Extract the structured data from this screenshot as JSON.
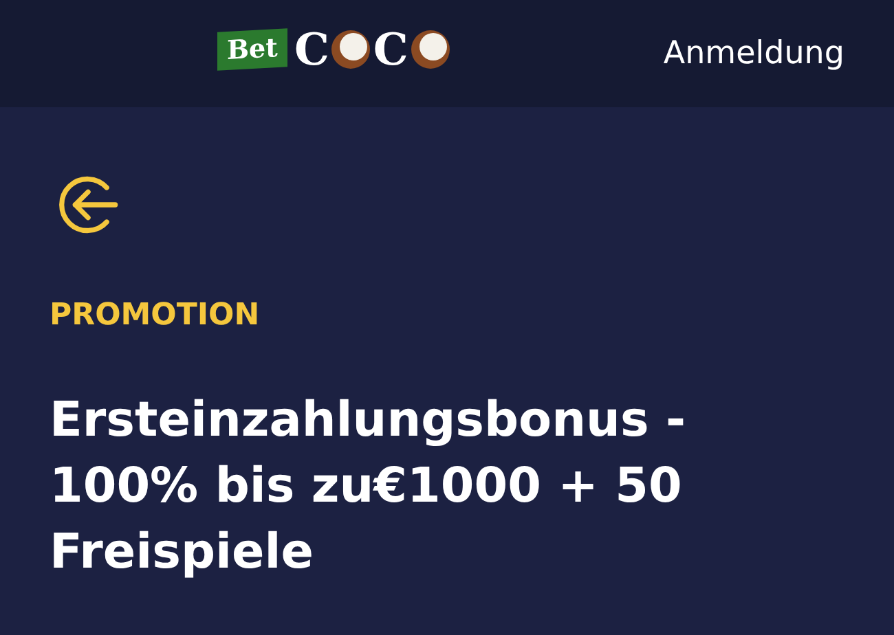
{
  "header": {
    "logo": {
      "badge": "Bet",
      "letters": [
        "C",
        "C"
      ]
    },
    "login_link": "Anmeldung"
  },
  "promo": {
    "category": "PROMOTION",
    "title": "Ersteinzahlungsbonus - 100% bis zu€1000 + 50 Freispiele"
  }
}
